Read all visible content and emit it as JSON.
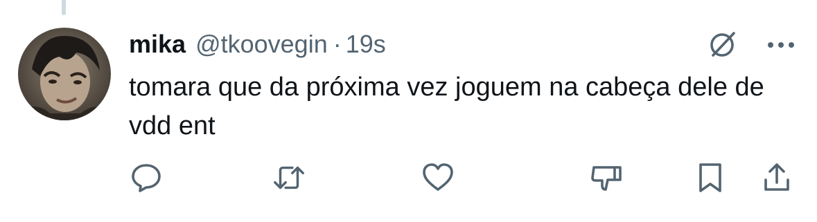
{
  "tweet": {
    "display_name": "mika",
    "handle": "@tkoovegin",
    "separator": "·",
    "time": "19s",
    "text": "tomara que da próxima vez joguem na cabeça dele de vdd ent"
  },
  "header_icons": [
    "grok-icon",
    "more-icon"
  ],
  "actions": [
    "reply-icon",
    "retweet-icon",
    "like-icon",
    "dislike-icon",
    "bookmark-icon",
    "share-icon"
  ],
  "colors": {
    "text": "#0f1419",
    "secondary": "#536471",
    "thread_line": "#cfd9de",
    "background": "#ffffff"
  }
}
